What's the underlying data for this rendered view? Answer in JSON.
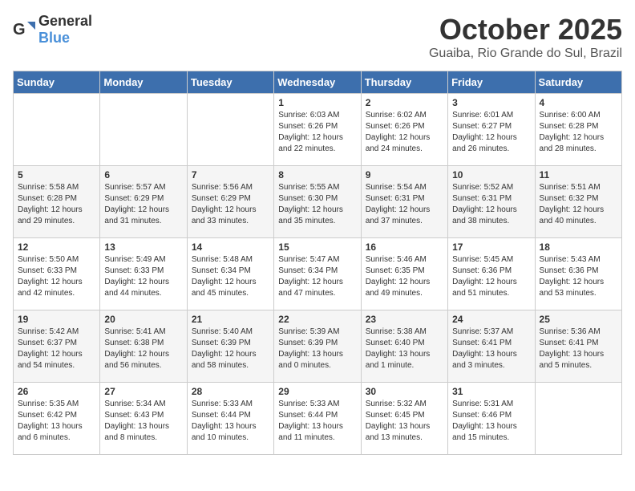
{
  "header": {
    "logo_general": "General",
    "logo_blue": "Blue",
    "month_year": "October 2025",
    "location": "Guaiba, Rio Grande do Sul, Brazil"
  },
  "days_of_week": [
    "Sunday",
    "Monday",
    "Tuesday",
    "Wednesday",
    "Thursday",
    "Friday",
    "Saturday"
  ],
  "weeks": [
    [
      {
        "day": "",
        "info": ""
      },
      {
        "day": "",
        "info": ""
      },
      {
        "day": "",
        "info": ""
      },
      {
        "day": "1",
        "info": "Sunrise: 6:03 AM\nSunset: 6:26 PM\nDaylight: 12 hours\nand 22 minutes."
      },
      {
        "day": "2",
        "info": "Sunrise: 6:02 AM\nSunset: 6:26 PM\nDaylight: 12 hours\nand 24 minutes."
      },
      {
        "day": "3",
        "info": "Sunrise: 6:01 AM\nSunset: 6:27 PM\nDaylight: 12 hours\nand 26 minutes."
      },
      {
        "day": "4",
        "info": "Sunrise: 6:00 AM\nSunset: 6:28 PM\nDaylight: 12 hours\nand 28 minutes."
      }
    ],
    [
      {
        "day": "5",
        "info": "Sunrise: 5:58 AM\nSunset: 6:28 PM\nDaylight: 12 hours\nand 29 minutes."
      },
      {
        "day": "6",
        "info": "Sunrise: 5:57 AM\nSunset: 6:29 PM\nDaylight: 12 hours\nand 31 minutes."
      },
      {
        "day": "7",
        "info": "Sunrise: 5:56 AM\nSunset: 6:29 PM\nDaylight: 12 hours\nand 33 minutes."
      },
      {
        "day": "8",
        "info": "Sunrise: 5:55 AM\nSunset: 6:30 PM\nDaylight: 12 hours\nand 35 minutes."
      },
      {
        "day": "9",
        "info": "Sunrise: 5:54 AM\nSunset: 6:31 PM\nDaylight: 12 hours\nand 37 minutes."
      },
      {
        "day": "10",
        "info": "Sunrise: 5:52 AM\nSunset: 6:31 PM\nDaylight: 12 hours\nand 38 minutes."
      },
      {
        "day": "11",
        "info": "Sunrise: 5:51 AM\nSunset: 6:32 PM\nDaylight: 12 hours\nand 40 minutes."
      }
    ],
    [
      {
        "day": "12",
        "info": "Sunrise: 5:50 AM\nSunset: 6:33 PM\nDaylight: 12 hours\nand 42 minutes."
      },
      {
        "day": "13",
        "info": "Sunrise: 5:49 AM\nSunset: 6:33 PM\nDaylight: 12 hours\nand 44 minutes."
      },
      {
        "day": "14",
        "info": "Sunrise: 5:48 AM\nSunset: 6:34 PM\nDaylight: 12 hours\nand 45 minutes."
      },
      {
        "day": "15",
        "info": "Sunrise: 5:47 AM\nSunset: 6:34 PM\nDaylight: 12 hours\nand 47 minutes."
      },
      {
        "day": "16",
        "info": "Sunrise: 5:46 AM\nSunset: 6:35 PM\nDaylight: 12 hours\nand 49 minutes."
      },
      {
        "day": "17",
        "info": "Sunrise: 5:45 AM\nSunset: 6:36 PM\nDaylight: 12 hours\nand 51 minutes."
      },
      {
        "day": "18",
        "info": "Sunrise: 5:43 AM\nSunset: 6:36 PM\nDaylight: 12 hours\nand 53 minutes."
      }
    ],
    [
      {
        "day": "19",
        "info": "Sunrise: 5:42 AM\nSunset: 6:37 PM\nDaylight: 12 hours\nand 54 minutes."
      },
      {
        "day": "20",
        "info": "Sunrise: 5:41 AM\nSunset: 6:38 PM\nDaylight: 12 hours\nand 56 minutes."
      },
      {
        "day": "21",
        "info": "Sunrise: 5:40 AM\nSunset: 6:39 PM\nDaylight: 12 hours\nand 58 minutes."
      },
      {
        "day": "22",
        "info": "Sunrise: 5:39 AM\nSunset: 6:39 PM\nDaylight: 13 hours\nand 0 minutes."
      },
      {
        "day": "23",
        "info": "Sunrise: 5:38 AM\nSunset: 6:40 PM\nDaylight: 13 hours\nand 1 minute."
      },
      {
        "day": "24",
        "info": "Sunrise: 5:37 AM\nSunset: 6:41 PM\nDaylight: 13 hours\nand 3 minutes."
      },
      {
        "day": "25",
        "info": "Sunrise: 5:36 AM\nSunset: 6:41 PM\nDaylight: 13 hours\nand 5 minutes."
      }
    ],
    [
      {
        "day": "26",
        "info": "Sunrise: 5:35 AM\nSunset: 6:42 PM\nDaylight: 13 hours\nand 6 minutes."
      },
      {
        "day": "27",
        "info": "Sunrise: 5:34 AM\nSunset: 6:43 PM\nDaylight: 13 hours\nand 8 minutes."
      },
      {
        "day": "28",
        "info": "Sunrise: 5:33 AM\nSunset: 6:44 PM\nDaylight: 13 hours\nand 10 minutes."
      },
      {
        "day": "29",
        "info": "Sunrise: 5:33 AM\nSunset: 6:44 PM\nDaylight: 13 hours\nand 11 minutes."
      },
      {
        "day": "30",
        "info": "Sunrise: 5:32 AM\nSunset: 6:45 PM\nDaylight: 13 hours\nand 13 minutes."
      },
      {
        "day": "31",
        "info": "Sunrise: 5:31 AM\nSunset: 6:46 PM\nDaylight: 13 hours\nand 15 minutes."
      },
      {
        "day": "",
        "info": ""
      }
    ]
  ]
}
